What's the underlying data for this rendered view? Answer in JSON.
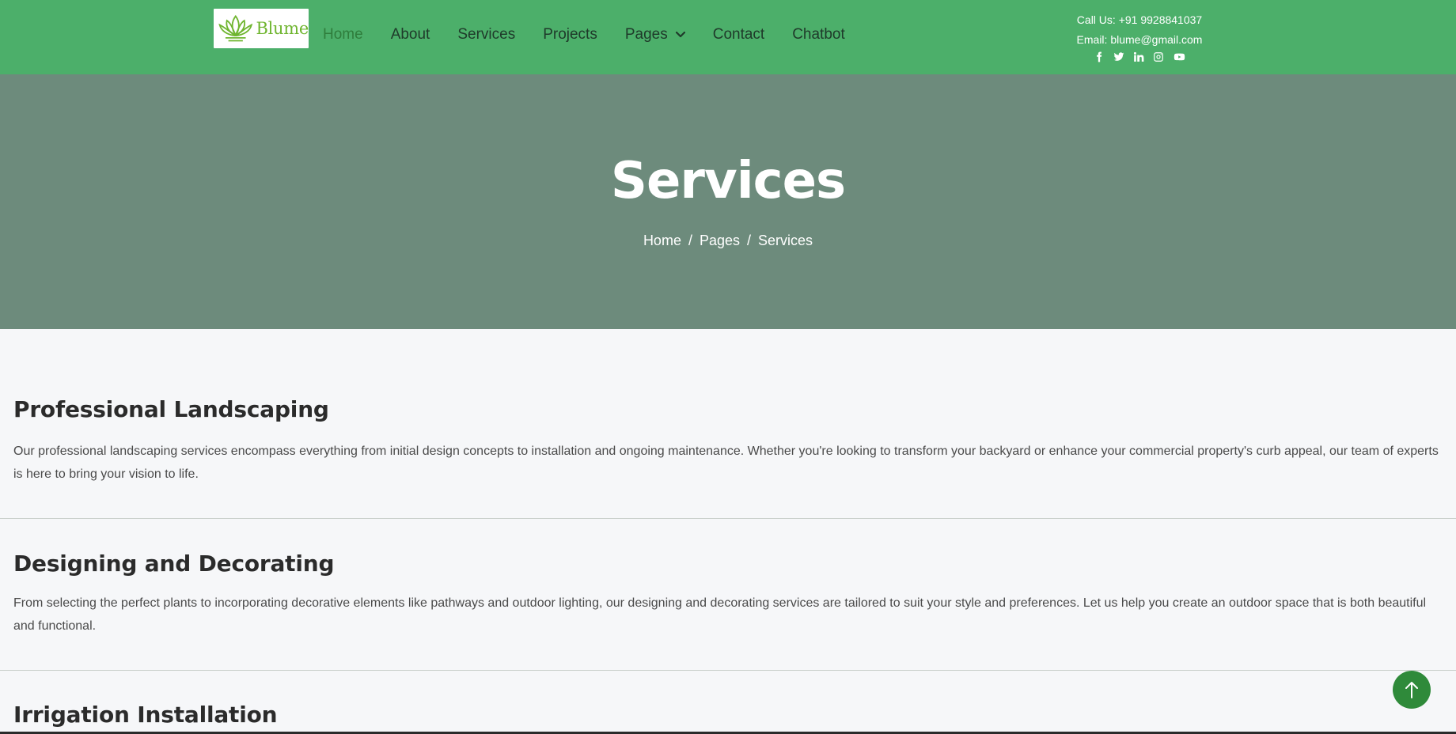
{
  "brand": {
    "name": "Blume"
  },
  "nav": {
    "items": [
      {
        "label": "Home",
        "active": true
      },
      {
        "label": "About"
      },
      {
        "label": "Services"
      },
      {
        "label": "Projects"
      },
      {
        "label": "Pages",
        "dropdown": true
      },
      {
        "label": "Contact"
      },
      {
        "label": "Chatbot"
      }
    ]
  },
  "contact": {
    "phone": "Call Us: +91 9928841037",
    "email": "Email: blume@gmail.com",
    "socials": [
      "facebook-icon",
      "twitter-icon",
      "linkedin-icon",
      "instagram-icon",
      "youtube-icon"
    ]
  },
  "hero": {
    "title": "Services",
    "breadcrumb": [
      "Home",
      "Pages",
      "Services"
    ],
    "separator": "/"
  },
  "services": [
    {
      "title": "Professional Landscaping",
      "text": "Our professional landscaping services encompass everything from initial design concepts to installation and ongoing maintenance. Whether you're looking to transform your backyard or enhance your commercial property's curb appeal, our team of experts is here to bring your vision to life."
    },
    {
      "title": "Designing and Decorating",
      "text": "From selecting the perfect plants to incorporating decorative elements like pathways and outdoor lighting, our designing and decorating services are tailored to suit your style and preferences. Let us help you create an outdoor space that is both beautiful and functional."
    },
    {
      "title": "Irrigation Installation",
      "text": ""
    }
  ],
  "colors": {
    "header_bg": "#4caf6a",
    "hero_bg": "#6d8b7c",
    "page_bg": "#f6f7f9",
    "accent": "#2f8a3a"
  }
}
